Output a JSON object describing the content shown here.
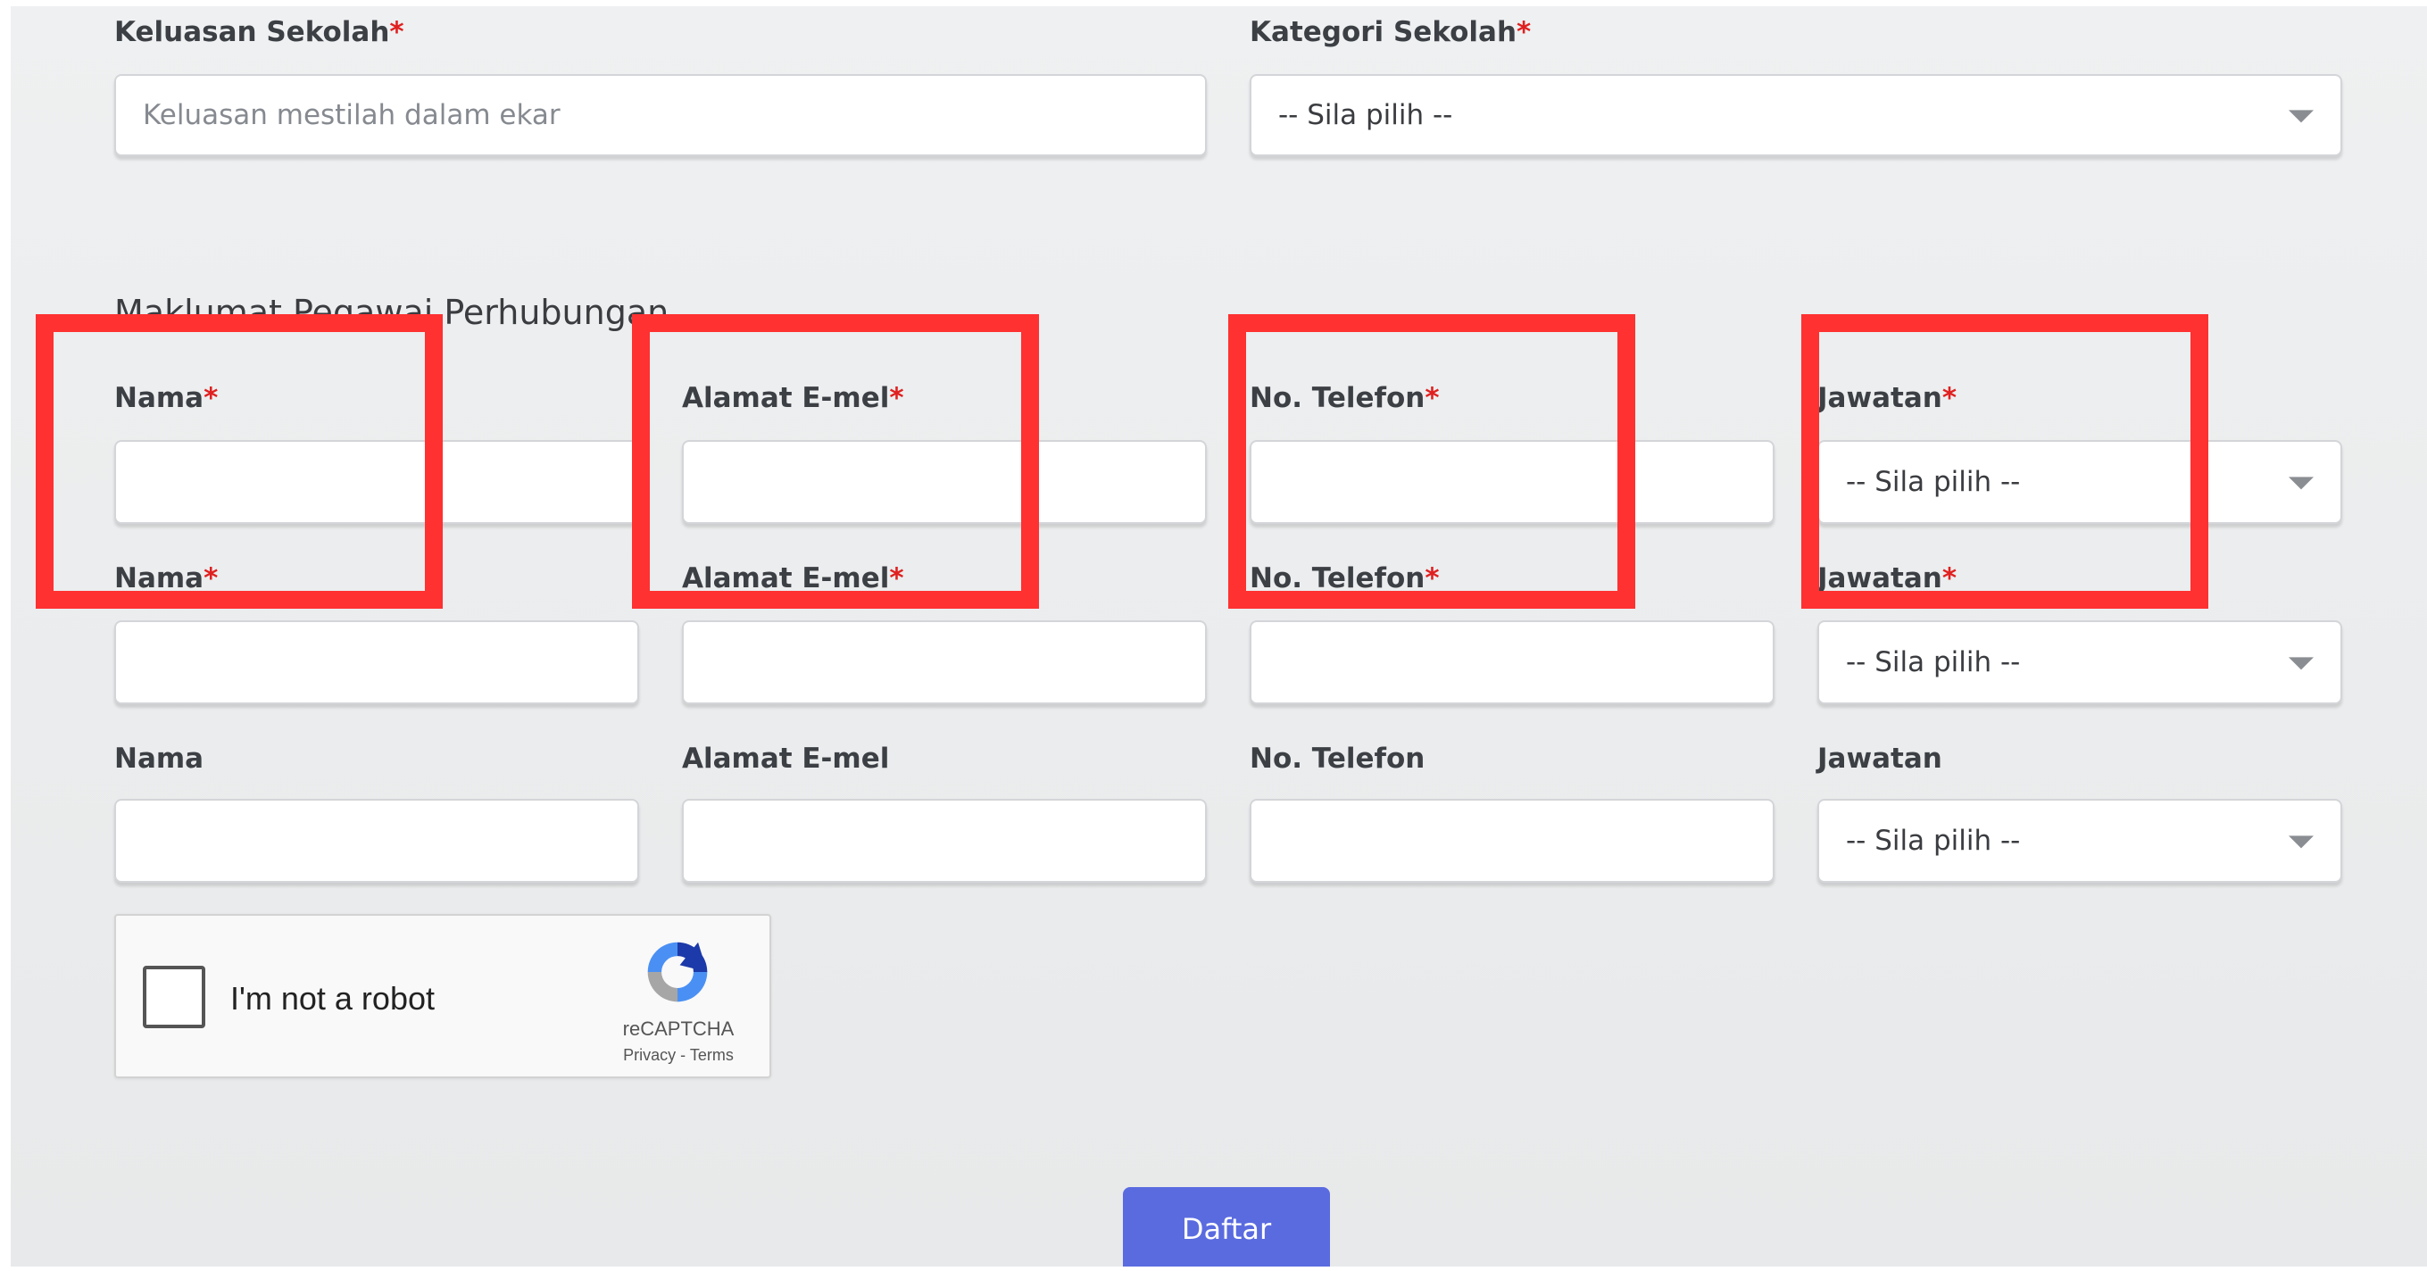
{
  "school": {
    "area": {
      "label": "Keluasan Sekolah",
      "required_mark": "*",
      "placeholder": "Keluasan mestilah dalam ekar"
    },
    "category": {
      "label": "Kategori Sekolah",
      "required_mark": "*",
      "selected": "-- Sila pilih --"
    }
  },
  "contact": {
    "section_title": "Maklumat Pegawai Perhubungan",
    "rows": [
      {
        "name_label": "Nama",
        "email_label": "Alamat E-mel",
        "phone_label": "No. Telefon",
        "position_label": "Jawatan",
        "required_mark": "*",
        "position_selected": "-- Sila pilih --"
      },
      {
        "name_label": "Nama",
        "email_label": "Alamat E-mel",
        "phone_label": "No. Telefon",
        "position_label": "Jawatan",
        "required_mark": "*",
        "position_selected": "-- Sila pilih --"
      },
      {
        "name_label": "Nama",
        "email_label": "Alamat E-mel",
        "phone_label": "No. Telefon",
        "position_label": "Jawatan",
        "required_mark": "",
        "position_selected": "-- Sila pilih --"
      }
    ]
  },
  "captcha": {
    "label": "I'm not a robot",
    "brand": "reCAPTCHA",
    "links": "Privacy - Terms"
  },
  "submit_label": "Daftar",
  "colors": {
    "required": "#e02020",
    "highlight": "#ff3131",
    "button": "#5a6be0"
  }
}
